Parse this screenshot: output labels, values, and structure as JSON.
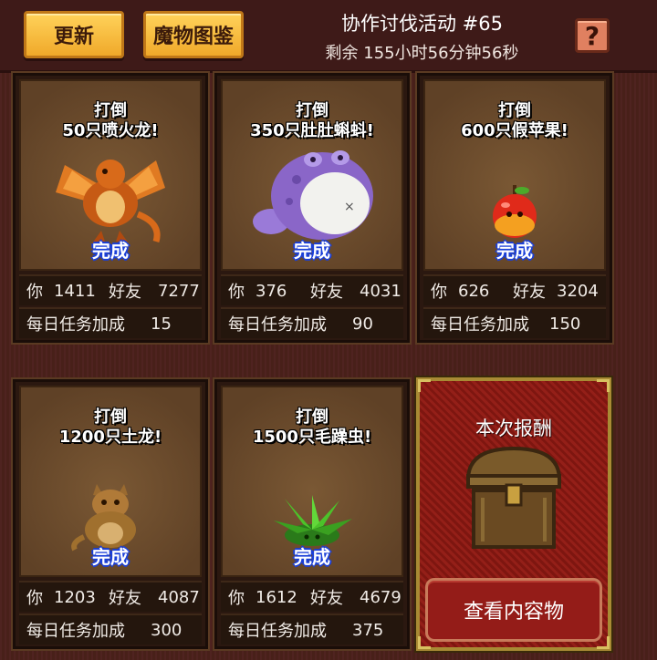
{
  "header": {
    "update_label": "更新",
    "bestiary_label": "魔物图鉴",
    "event_title": "协作讨伐活动 #65",
    "remaining": "剩余 155小时56分钟56秒",
    "help_symbol": "?"
  },
  "cards": [
    {
      "line1": "打倒",
      "line2": "50只喷火龙!",
      "status": "完成",
      "you_label": "你",
      "you": "1411",
      "friends_label": "好友",
      "friends": "7277",
      "bonus_label": "每日任务加成",
      "bonus": "15",
      "monster_icon": "fire-dragon-icon"
    },
    {
      "line1": "打倒",
      "line2": "350只肚肚蝌蚪!",
      "status": "完成",
      "you_label": "你",
      "you": "376",
      "friends_label": "好友",
      "friends": "4031",
      "bonus_label": "每日任务加成",
      "bonus": "90",
      "monster_icon": "tadpole-icon"
    },
    {
      "line1": "打倒",
      "line2": "600只假苹果!",
      "status": "完成",
      "you_label": "你",
      "you": "626",
      "friends_label": "好友",
      "friends": "3204",
      "bonus_label": "每日任务加成",
      "bonus": "150",
      "monster_icon": "fake-apple-icon"
    },
    {
      "line1": "打倒",
      "line2": "1200只土龙!",
      "status": "完成",
      "you_label": "你",
      "you": "1203",
      "friends_label": "好友",
      "friends": "4087",
      "bonus_label": "每日任务加成",
      "bonus": "300",
      "monster_icon": "earth-dragon-icon"
    },
    {
      "line1": "打倒",
      "line2": "1500只毛躁虫!",
      "status": "完成",
      "you_label": "你",
      "you": "1612",
      "friends_label": "好友",
      "friends": "4679",
      "bonus_label": "每日任务加成",
      "bonus": "375",
      "monster_icon": "leaf-bug-icon"
    }
  ],
  "reward": {
    "title": "本次报酬",
    "view_label": "查看内容物",
    "chest_icon": "treasure-chest-icon"
  },
  "colors": {
    "done_outline": "#1a3fd8",
    "button_yellow": "#f0a92a",
    "reward_red": "#8a1a14"
  }
}
